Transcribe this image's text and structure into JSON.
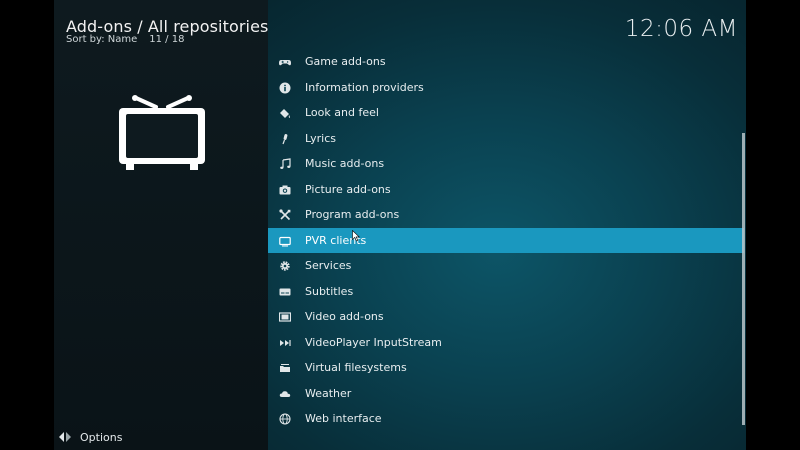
{
  "header": {
    "title": "Add-ons / All repositories",
    "sort_label": "Sort by: Name",
    "position": "11 / 18"
  },
  "clock": "12:06 AM",
  "category_icon": "tv-icon",
  "list": {
    "selected_index": 7,
    "items": [
      {
        "label": "Game add-ons",
        "icon": "gamepad-icon"
      },
      {
        "label": "Information providers",
        "icon": "info-icon"
      },
      {
        "label": "Look and feel",
        "icon": "paint-bucket-icon"
      },
      {
        "label": "Lyrics",
        "icon": "microphone-icon"
      },
      {
        "label": "Music add-ons",
        "icon": "music-note-icon"
      },
      {
        "label": "Picture add-ons",
        "icon": "camera-icon"
      },
      {
        "label": "Program add-ons",
        "icon": "tools-icon"
      },
      {
        "label": "PVR clients",
        "icon": "tv-small-icon"
      },
      {
        "label": "Services",
        "icon": "gear-icon"
      },
      {
        "label": "Subtitles",
        "icon": "subtitles-icon"
      },
      {
        "label": "Video add-ons",
        "icon": "film-icon"
      },
      {
        "label": "VideoPlayer InputStream",
        "icon": "play-stream-icon"
      },
      {
        "label": "Virtual filesystems",
        "icon": "folder-stack-icon"
      },
      {
        "label": "Weather",
        "icon": "cloud-icon"
      },
      {
        "label": "Web interface",
        "icon": "globe-icon"
      }
    ]
  },
  "footer": {
    "options_label": "Options",
    "options_icon": "options-arrows-icon"
  },
  "colors": {
    "selection": "#1a98bf",
    "text": "#e8eef0",
    "panel_dark": "#0b1418",
    "panel_teal": "#0a4150"
  }
}
